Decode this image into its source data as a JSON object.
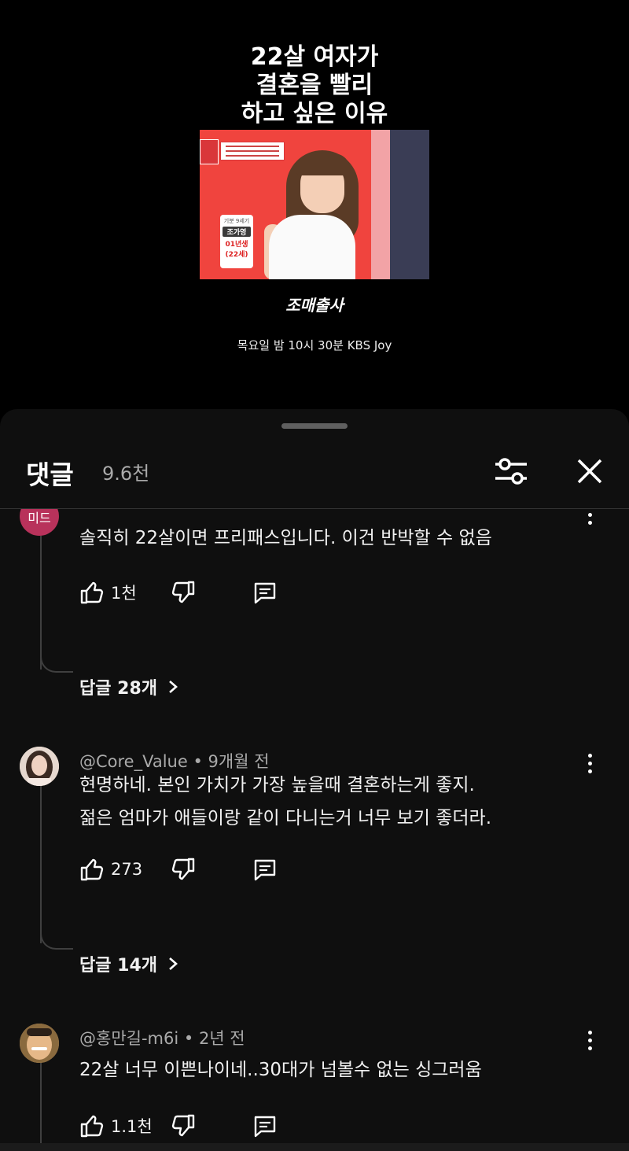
{
  "video": {
    "title_line1": "22살 여자가",
    "title_line2": "결혼을 빨리",
    "title_line3": "하고 싶은 이유",
    "name_card": {
      "role": "기분 9세기",
      "name": "조가영",
      "year": "01년생",
      "age": "(22세)"
    },
    "show_logo": "조매출사",
    "airtime": "목요일 밤 10시 30분 KBS Joy"
  },
  "panel": {
    "title": "댓글",
    "count": "9.6천",
    "filter_icon": "filter-sliders-icon",
    "close_icon": "close-icon"
  },
  "comments": [
    {
      "avatar_text": "미드",
      "avatar_color": "#b8325b",
      "text": "솔직히 22살이면 프리패스입니다. 이건 반박할 수 없음",
      "likes": "1천",
      "replies": "답글 28개"
    },
    {
      "author": "@Core_Value",
      "time": "• 9개월 전",
      "text_line1": "현명하네. 본인 가치가 가장 높을때 결혼하는게 좋지.",
      "text_line2": "젊은 엄마가 애들이랑 같이 다니는거 너무 보기 좋더라.",
      "likes": "273",
      "replies": "답글 14개"
    },
    {
      "author": "@홍만길-m6i",
      "time": "• 2년 전",
      "text": "22살 너무 이쁜나이네..30대가 넘볼수 없는 싱그러움",
      "likes": "1.1천"
    }
  ]
}
